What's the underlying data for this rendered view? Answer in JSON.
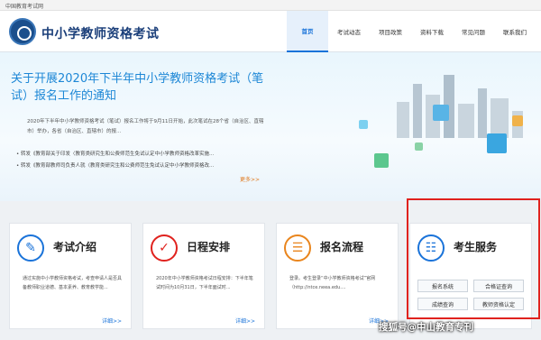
{
  "topbar": {
    "text": "中国教育考试网"
  },
  "header": {
    "title": "中小学教师资格考试"
  },
  "nav": {
    "items": [
      {
        "label": "首页"
      },
      {
        "label": "考试动态"
      },
      {
        "label": "项目政策"
      },
      {
        "label": "资料下载"
      },
      {
        "label": "常见问题"
      },
      {
        "label": "联系我们"
      }
    ]
  },
  "banner": {
    "title": "关于开展2020年下半年中小学教师资格考试（笔试）报名工作的通知",
    "desc": "2020年下半年中小学教师资格考试（笔试）报名工作将于9月11日开始，此次笔试在28个省（自治区、直辖市）举办，各省（自治区、直辖市）的报...",
    "list": [
      "转发《教育部关于印发〈教育类研究生和公费师范生免试认定中小学教师资格改革实施...",
      "转发《教育部教师司负责人就〈教育类研究生和公费师范生免试认定中小学教师资格改..."
    ],
    "more": "更多>>"
  },
  "cards": [
    {
      "title": "考试介绍",
      "desc": "通过实施中小学教师资格考试，考查申请人是否具备教师职业道德、基本素养、教育教学能...",
      "more": "详细>>"
    },
    {
      "title": "日程安排",
      "desc": "2020年中小学教师资格考试日程安排：下半年笔试时间为10月31日，下半年面试时...",
      "more": "详细>>"
    },
    {
      "title": "报名流程",
      "desc": "登录。考生登录“中小学教师资格考试”官网（http://ntce.neea.edu....",
      "more": "详细>>"
    },
    {
      "title": "考生服务",
      "buttons": [
        "报名系统",
        "合格证查询",
        "成绩查询",
        "教师资格认定"
      ]
    }
  ],
  "watermark": "搜狐号@中山教育专刊",
  "colors": {
    "brand": "#1b3f7a",
    "accent": "#1a73d9",
    "highlight": "#e0221e"
  }
}
